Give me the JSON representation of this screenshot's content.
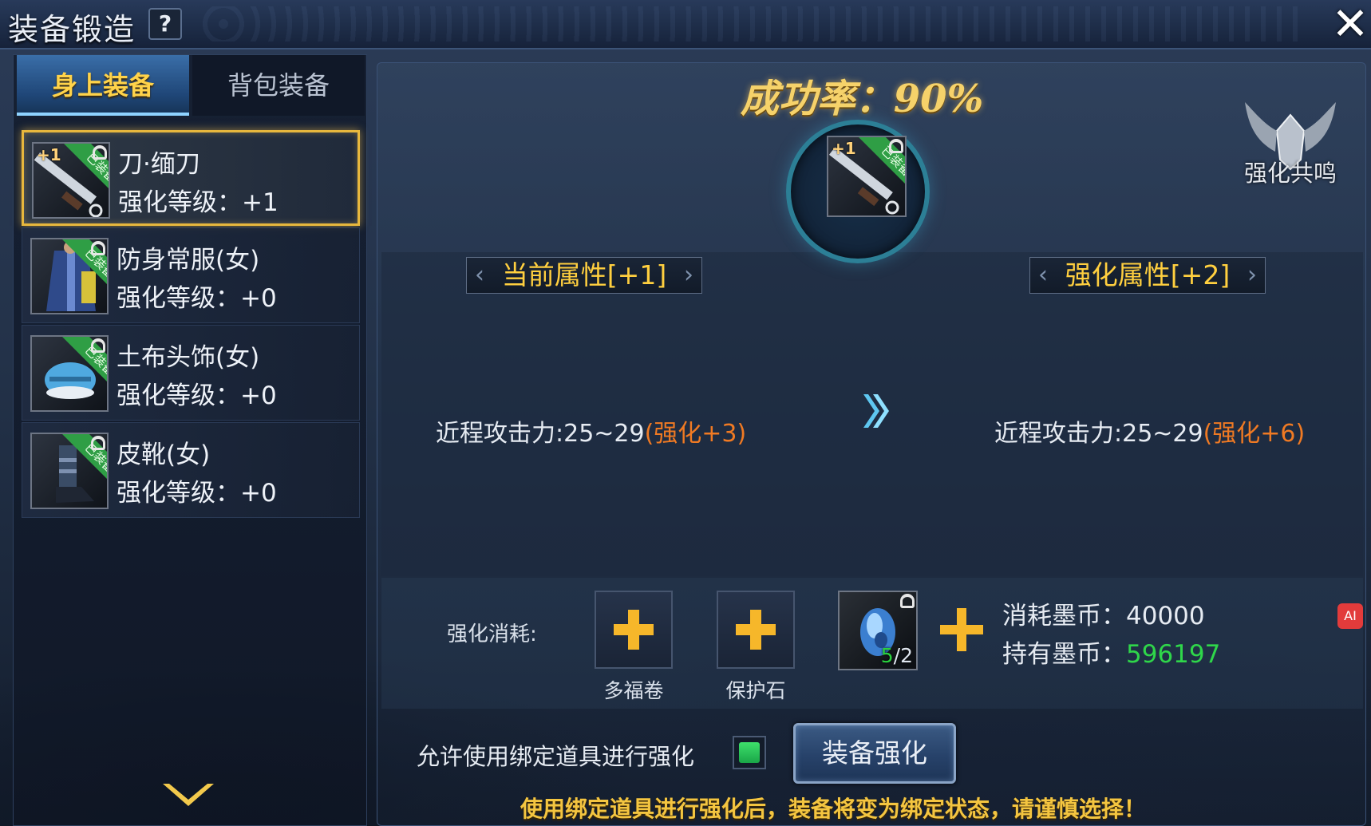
{
  "window": {
    "title": "装备锻造",
    "help_label": "?",
    "close_label": "✕"
  },
  "tabs": [
    {
      "label": "身上装备",
      "active": true
    },
    {
      "label": "背包装备",
      "active": false
    }
  ],
  "equipment": [
    {
      "name": "刀·缅刀",
      "level": "强化等级：+1",
      "badge": "已装备",
      "plus": "+1",
      "selected": true,
      "icon": "blade-icon"
    },
    {
      "name": "防身常服(女)",
      "level": "强化等级：+0",
      "badge": "已装备",
      "plus": "",
      "selected": false,
      "icon": "robe-icon"
    },
    {
      "name": "土布头饰(女)",
      "level": "强化等级：+0",
      "badge": "已装备",
      "plus": "",
      "selected": false,
      "icon": "headwear-icon"
    },
    {
      "name": "皮靴(女)",
      "level": "强化等级：+0",
      "badge": "已装备",
      "plus": "",
      "selected": false,
      "icon": "boots-icon"
    }
  ],
  "forge": {
    "success_rate": "成功率：90%",
    "center_item_plus": "+1",
    "center_item_badge": "已装备",
    "resonance_label": "强化共鸣",
    "current_header": "当前属性[+1]",
    "next_header": "强化属性[+2]",
    "current_stat": {
      "base": "近程攻击力:25~29",
      "bonus": "(强化+3)"
    },
    "next_stat": {
      "base": "近程攻击力:25~29",
      "bonus": "(强化+6)"
    }
  },
  "cost": {
    "label": "强化消耗:",
    "slot1_label": "多福卷",
    "slot2_label": "保护石",
    "gem_have": "5",
    "gem_need": "/2",
    "coin_cost_label": "消耗墨币：",
    "coin_cost_value": "40000",
    "coin_have_label": "持有墨币：",
    "coin_have_value": "596197"
  },
  "bind": {
    "label": "允许使用绑定道具进行强化",
    "checked": true
  },
  "forge_button": "装备强化",
  "warning": "使用绑定道具进行强化后，装备将变为绑定状态，请谨慎选择！",
  "side_badge": "AI",
  "colors": {
    "gold": "#ffcf3f",
    "orange_bonus": "#f07a23",
    "green_value": "#2fd64a",
    "ribbon_green": "#2f9e45",
    "selected_border": "#e7b73d"
  }
}
